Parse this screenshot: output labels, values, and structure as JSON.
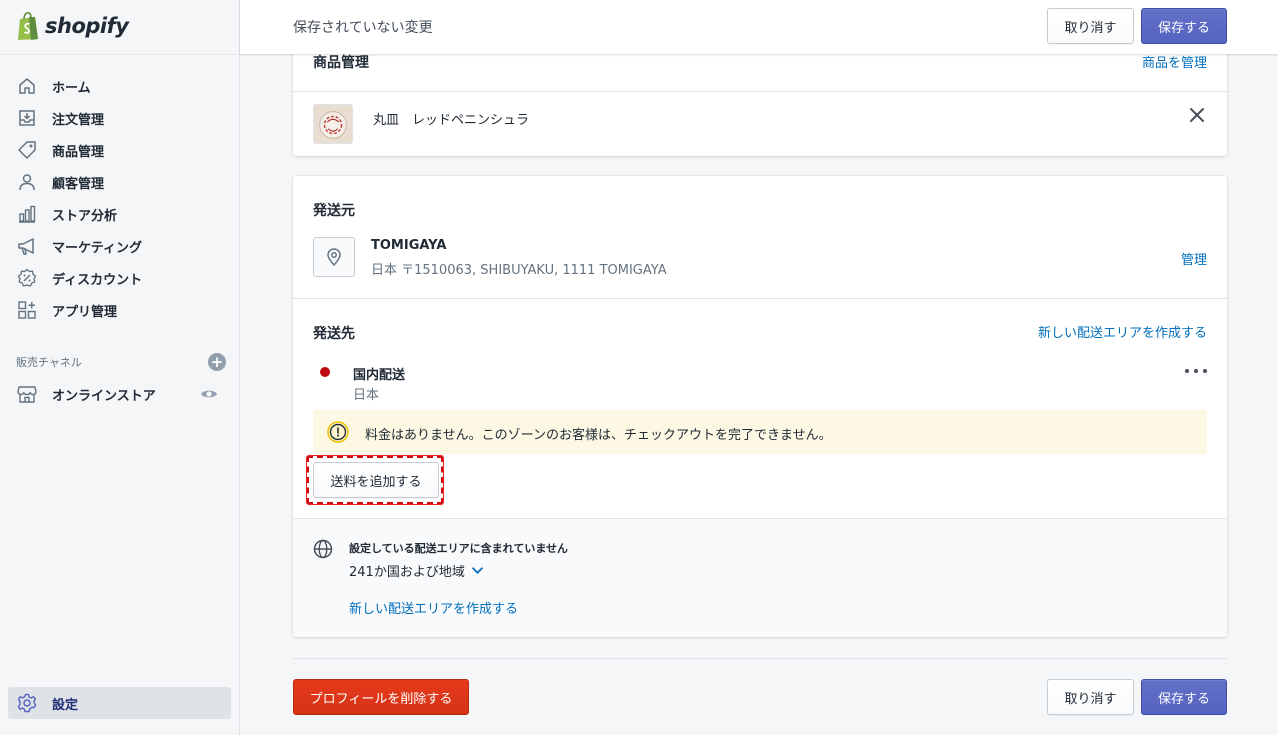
{
  "app": {
    "brand": "shopify"
  },
  "sidebar": {
    "items": [
      {
        "label": "ホーム",
        "icon": "home-icon"
      },
      {
        "label": "注文管理",
        "icon": "orders-icon"
      },
      {
        "label": "商品管理",
        "icon": "tag-icon"
      },
      {
        "label": "顧客管理",
        "icon": "customer-icon"
      },
      {
        "label": "ストア分析",
        "icon": "analytics-icon"
      },
      {
        "label": "マーケティング",
        "icon": "megaphone-icon"
      },
      {
        "label": "ディスカウント",
        "icon": "discount-icon"
      },
      {
        "label": "アプリ管理",
        "icon": "apps-icon"
      }
    ],
    "channels_heading": "販売チャネル",
    "channels": [
      {
        "label": "オンラインストア",
        "icon": "store-icon"
      }
    ],
    "settings_label": "設定"
  },
  "topbar": {
    "title": "保存されていない変更",
    "discard_label": "取り消す",
    "save_label": "保存する"
  },
  "products_card": {
    "heading": "商品管理",
    "manage_link": "商品を管理",
    "product_name": "丸皿　レッドペニンシュラ"
  },
  "origin_card": {
    "heading": "発送元",
    "location_name": "TOMIGAYA",
    "location_address": "日本 〒1510063, SHIBUYAKU, 1111 TOMIGAYA",
    "manage_link": "管理",
    "dest_heading": "発送先",
    "create_zone_link": "新しい配送エリアを作成する",
    "zone": {
      "name": "国内配送",
      "country": "日本"
    },
    "warning": "料金はありません。このゾーンのお客様は、チェックアウトを完了できません。",
    "add_rate_label": "送料を追加する",
    "rest_of_world": {
      "title": "設定している配送エリアに含まれていません",
      "count": "241か国および地域",
      "create_link": "新しい配送エリアを作成する"
    }
  },
  "footer": {
    "delete_label": "プロフィールを削除する",
    "discard_label": "取り消す",
    "save_label": "保存する"
  },
  "colors": {
    "primary": "#5c6ac4",
    "danger": "#de3618",
    "link": "#006fbb",
    "warning_bg": "#fcf8e3",
    "zone_dot": "#bf0711"
  }
}
